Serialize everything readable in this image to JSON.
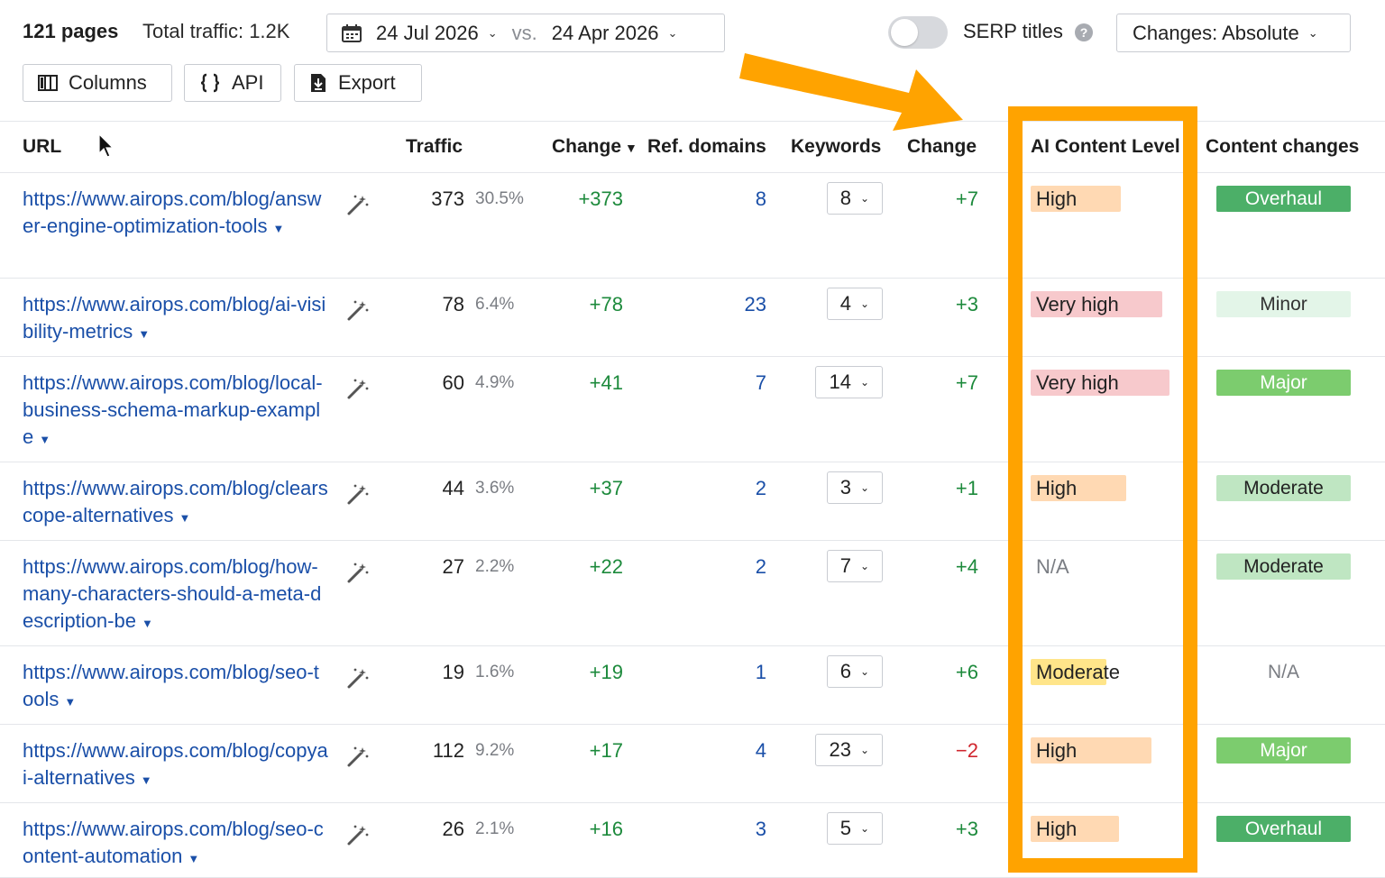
{
  "toolbar": {
    "pages_count": "121 pages",
    "total_traffic": "Total traffic: 1.2K",
    "date_current": "24 Jul 2026",
    "vs_label": "vs.",
    "date_compare": "24 Apr 2026",
    "serp_toggle_on": false,
    "serp_label": "SERP titles",
    "help_glyph": "?",
    "changes_select": "Changes: Absolute",
    "columns_label": "Columns",
    "api_label": "API",
    "export_label": "Export"
  },
  "headers": {
    "url": "URL",
    "traffic": "Traffic",
    "change": "Change",
    "ref_domains": "Ref. domains",
    "keywords": "Keywords",
    "change2": "Change",
    "ai_content_level": "AI Content Level",
    "content_changes": "Content changes"
  },
  "rows": [
    {
      "url": "https://www.airops.com/blog/answer-engine-optimization-tools",
      "traffic": "373",
      "pct": "30.5%",
      "change": "+373",
      "ref": "8",
      "keywords": "8",
      "kw_change": "+7",
      "ai": "High",
      "cc": "Overhaul"
    },
    {
      "url": "https://www.airops.com/blog/ai-visibility-metrics",
      "traffic": "78",
      "pct": "6.4%",
      "change": "+78",
      "ref": "23",
      "keywords": "4",
      "kw_change": "+3",
      "ai": "Very high",
      "cc": "Minor"
    },
    {
      "url": "https://www.airops.com/blog/local-business-schema-markup-example",
      "traffic": "60",
      "pct": "4.9%",
      "change": "+41",
      "ref": "7",
      "keywords": "14",
      "kw_change": "+7",
      "ai": "Very high",
      "cc": "Major"
    },
    {
      "url": "https://www.airops.com/blog/clearscope-alternatives",
      "traffic": "44",
      "pct": "3.6%",
      "change": "+37",
      "ref": "2",
      "keywords": "3",
      "kw_change": "+1",
      "ai": "High",
      "cc": "Moderate"
    },
    {
      "url": "https://www.airops.com/blog/how-many-characters-should-a-meta-description-be",
      "traffic": "27",
      "pct": "2.2%",
      "change": "+22",
      "ref": "2",
      "keywords": "7",
      "kw_change": "+4",
      "ai": "N/A",
      "cc": "Moderate"
    },
    {
      "url": "https://www.airops.com/blog/seo-tools",
      "traffic": "19",
      "pct": "1.6%",
      "change": "+19",
      "ref": "1",
      "keywords": "6",
      "kw_change": "+6",
      "ai": "Moderate",
      "cc": "N/A"
    },
    {
      "url": "https://www.airops.com/blog/copyai-alternatives",
      "traffic": "112",
      "pct": "9.2%",
      "change": "+17",
      "ref": "4",
      "keywords": "23",
      "kw_change": "−2",
      "ai": "High",
      "cc": "Major"
    },
    {
      "url": "https://www.airops.com/blog/seo-content-automation",
      "traffic": "26",
      "pct": "2.1%",
      "change": "+16",
      "ref": "3",
      "keywords": "5",
      "kw_change": "+3",
      "ai": "High",
      "cc": "Overhaul"
    }
  ],
  "colors": {
    "highlight": "#ffa300",
    "link": "#1a4fa8",
    "positive": "#1d8a3c",
    "negative": "#d0262e"
  },
  "icons": {
    "calendar": "calendar-icon",
    "columns": "columns-icon",
    "api": "braces-icon",
    "export": "download-icon",
    "wand": "magic-wand-icon"
  }
}
